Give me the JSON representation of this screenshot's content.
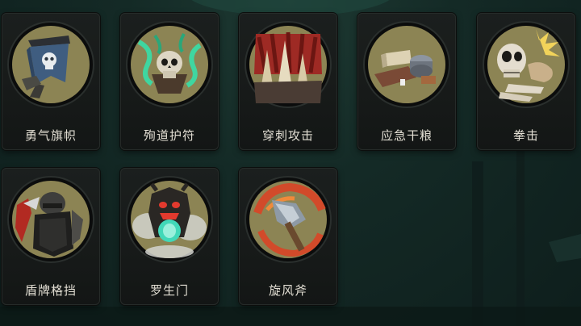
{
  "skills": [
    {
      "id": "banner",
      "label": "勇气旗帜",
      "icon": "skull-banner-icon"
    },
    {
      "id": "martyr",
      "label": "殉道护符",
      "icon": "green-skull-amulet-icon"
    },
    {
      "id": "pierce",
      "label": "穿刺攻击",
      "icon": "spikes-icon"
    },
    {
      "id": "ration",
      "label": "应急干粮",
      "icon": "rations-icon"
    },
    {
      "id": "punch",
      "label": "拳击",
      "icon": "skeleton-punch-icon"
    },
    {
      "id": "shield",
      "label": "盾牌格挡",
      "icon": "shield-knight-icon"
    },
    {
      "id": "gate",
      "label": "罗生门",
      "icon": "demon-gate-icon"
    },
    {
      "id": "axe",
      "label": "旋风斧",
      "icon": "whirlwind-axe-icon"
    }
  ],
  "colors": {
    "medal_bg": "#8c8454",
    "card_bg": "#1b1f1e",
    "label": "#e2ded3",
    "backdrop": "#142a26"
  }
}
